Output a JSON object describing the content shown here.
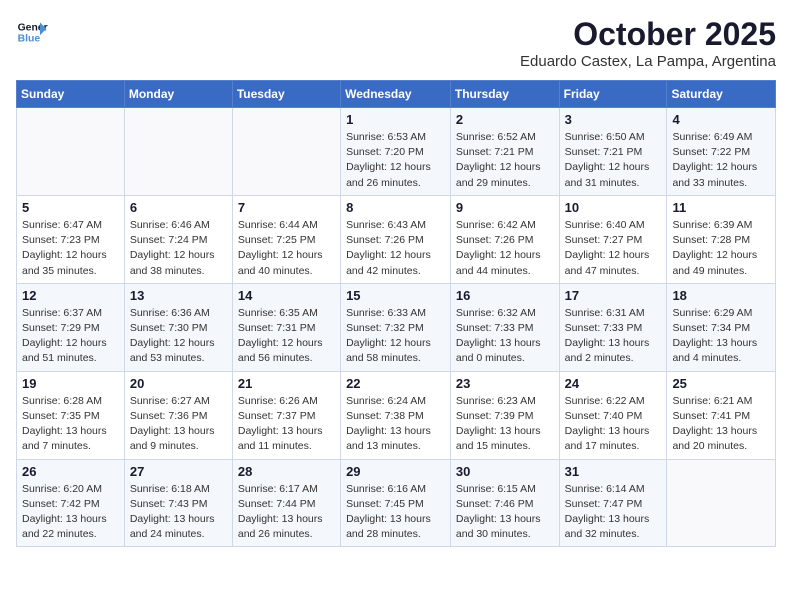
{
  "logo": {
    "line1": "General",
    "line2": "Blue"
  },
  "title": "October 2025",
  "location": "Eduardo Castex, La Pampa, Argentina",
  "days_of_week": [
    "Sunday",
    "Monday",
    "Tuesday",
    "Wednesday",
    "Thursday",
    "Friday",
    "Saturday"
  ],
  "weeks": [
    [
      {
        "num": "",
        "info": ""
      },
      {
        "num": "",
        "info": ""
      },
      {
        "num": "",
        "info": ""
      },
      {
        "num": "1",
        "info": "Sunrise: 6:53 AM\nSunset: 7:20 PM\nDaylight: 12 hours\nand 26 minutes."
      },
      {
        "num": "2",
        "info": "Sunrise: 6:52 AM\nSunset: 7:21 PM\nDaylight: 12 hours\nand 29 minutes."
      },
      {
        "num": "3",
        "info": "Sunrise: 6:50 AM\nSunset: 7:21 PM\nDaylight: 12 hours\nand 31 minutes."
      },
      {
        "num": "4",
        "info": "Sunrise: 6:49 AM\nSunset: 7:22 PM\nDaylight: 12 hours\nand 33 minutes."
      }
    ],
    [
      {
        "num": "5",
        "info": "Sunrise: 6:47 AM\nSunset: 7:23 PM\nDaylight: 12 hours\nand 35 minutes."
      },
      {
        "num": "6",
        "info": "Sunrise: 6:46 AM\nSunset: 7:24 PM\nDaylight: 12 hours\nand 38 minutes."
      },
      {
        "num": "7",
        "info": "Sunrise: 6:44 AM\nSunset: 7:25 PM\nDaylight: 12 hours\nand 40 minutes."
      },
      {
        "num": "8",
        "info": "Sunrise: 6:43 AM\nSunset: 7:26 PM\nDaylight: 12 hours\nand 42 minutes."
      },
      {
        "num": "9",
        "info": "Sunrise: 6:42 AM\nSunset: 7:26 PM\nDaylight: 12 hours\nand 44 minutes."
      },
      {
        "num": "10",
        "info": "Sunrise: 6:40 AM\nSunset: 7:27 PM\nDaylight: 12 hours\nand 47 minutes."
      },
      {
        "num": "11",
        "info": "Sunrise: 6:39 AM\nSunset: 7:28 PM\nDaylight: 12 hours\nand 49 minutes."
      }
    ],
    [
      {
        "num": "12",
        "info": "Sunrise: 6:37 AM\nSunset: 7:29 PM\nDaylight: 12 hours\nand 51 minutes."
      },
      {
        "num": "13",
        "info": "Sunrise: 6:36 AM\nSunset: 7:30 PM\nDaylight: 12 hours\nand 53 minutes."
      },
      {
        "num": "14",
        "info": "Sunrise: 6:35 AM\nSunset: 7:31 PM\nDaylight: 12 hours\nand 56 minutes."
      },
      {
        "num": "15",
        "info": "Sunrise: 6:33 AM\nSunset: 7:32 PM\nDaylight: 12 hours\nand 58 minutes."
      },
      {
        "num": "16",
        "info": "Sunrise: 6:32 AM\nSunset: 7:33 PM\nDaylight: 13 hours\nand 0 minutes."
      },
      {
        "num": "17",
        "info": "Sunrise: 6:31 AM\nSunset: 7:33 PM\nDaylight: 13 hours\nand 2 minutes."
      },
      {
        "num": "18",
        "info": "Sunrise: 6:29 AM\nSunset: 7:34 PM\nDaylight: 13 hours\nand 4 minutes."
      }
    ],
    [
      {
        "num": "19",
        "info": "Sunrise: 6:28 AM\nSunset: 7:35 PM\nDaylight: 13 hours\nand 7 minutes."
      },
      {
        "num": "20",
        "info": "Sunrise: 6:27 AM\nSunset: 7:36 PM\nDaylight: 13 hours\nand 9 minutes."
      },
      {
        "num": "21",
        "info": "Sunrise: 6:26 AM\nSunset: 7:37 PM\nDaylight: 13 hours\nand 11 minutes."
      },
      {
        "num": "22",
        "info": "Sunrise: 6:24 AM\nSunset: 7:38 PM\nDaylight: 13 hours\nand 13 minutes."
      },
      {
        "num": "23",
        "info": "Sunrise: 6:23 AM\nSunset: 7:39 PM\nDaylight: 13 hours\nand 15 minutes."
      },
      {
        "num": "24",
        "info": "Sunrise: 6:22 AM\nSunset: 7:40 PM\nDaylight: 13 hours\nand 17 minutes."
      },
      {
        "num": "25",
        "info": "Sunrise: 6:21 AM\nSunset: 7:41 PM\nDaylight: 13 hours\nand 20 minutes."
      }
    ],
    [
      {
        "num": "26",
        "info": "Sunrise: 6:20 AM\nSunset: 7:42 PM\nDaylight: 13 hours\nand 22 minutes."
      },
      {
        "num": "27",
        "info": "Sunrise: 6:18 AM\nSunset: 7:43 PM\nDaylight: 13 hours\nand 24 minutes."
      },
      {
        "num": "28",
        "info": "Sunrise: 6:17 AM\nSunset: 7:44 PM\nDaylight: 13 hours\nand 26 minutes."
      },
      {
        "num": "29",
        "info": "Sunrise: 6:16 AM\nSunset: 7:45 PM\nDaylight: 13 hours\nand 28 minutes."
      },
      {
        "num": "30",
        "info": "Sunrise: 6:15 AM\nSunset: 7:46 PM\nDaylight: 13 hours\nand 30 minutes."
      },
      {
        "num": "31",
        "info": "Sunrise: 6:14 AM\nSunset: 7:47 PM\nDaylight: 13 hours\nand 32 minutes."
      },
      {
        "num": "",
        "info": ""
      }
    ]
  ]
}
